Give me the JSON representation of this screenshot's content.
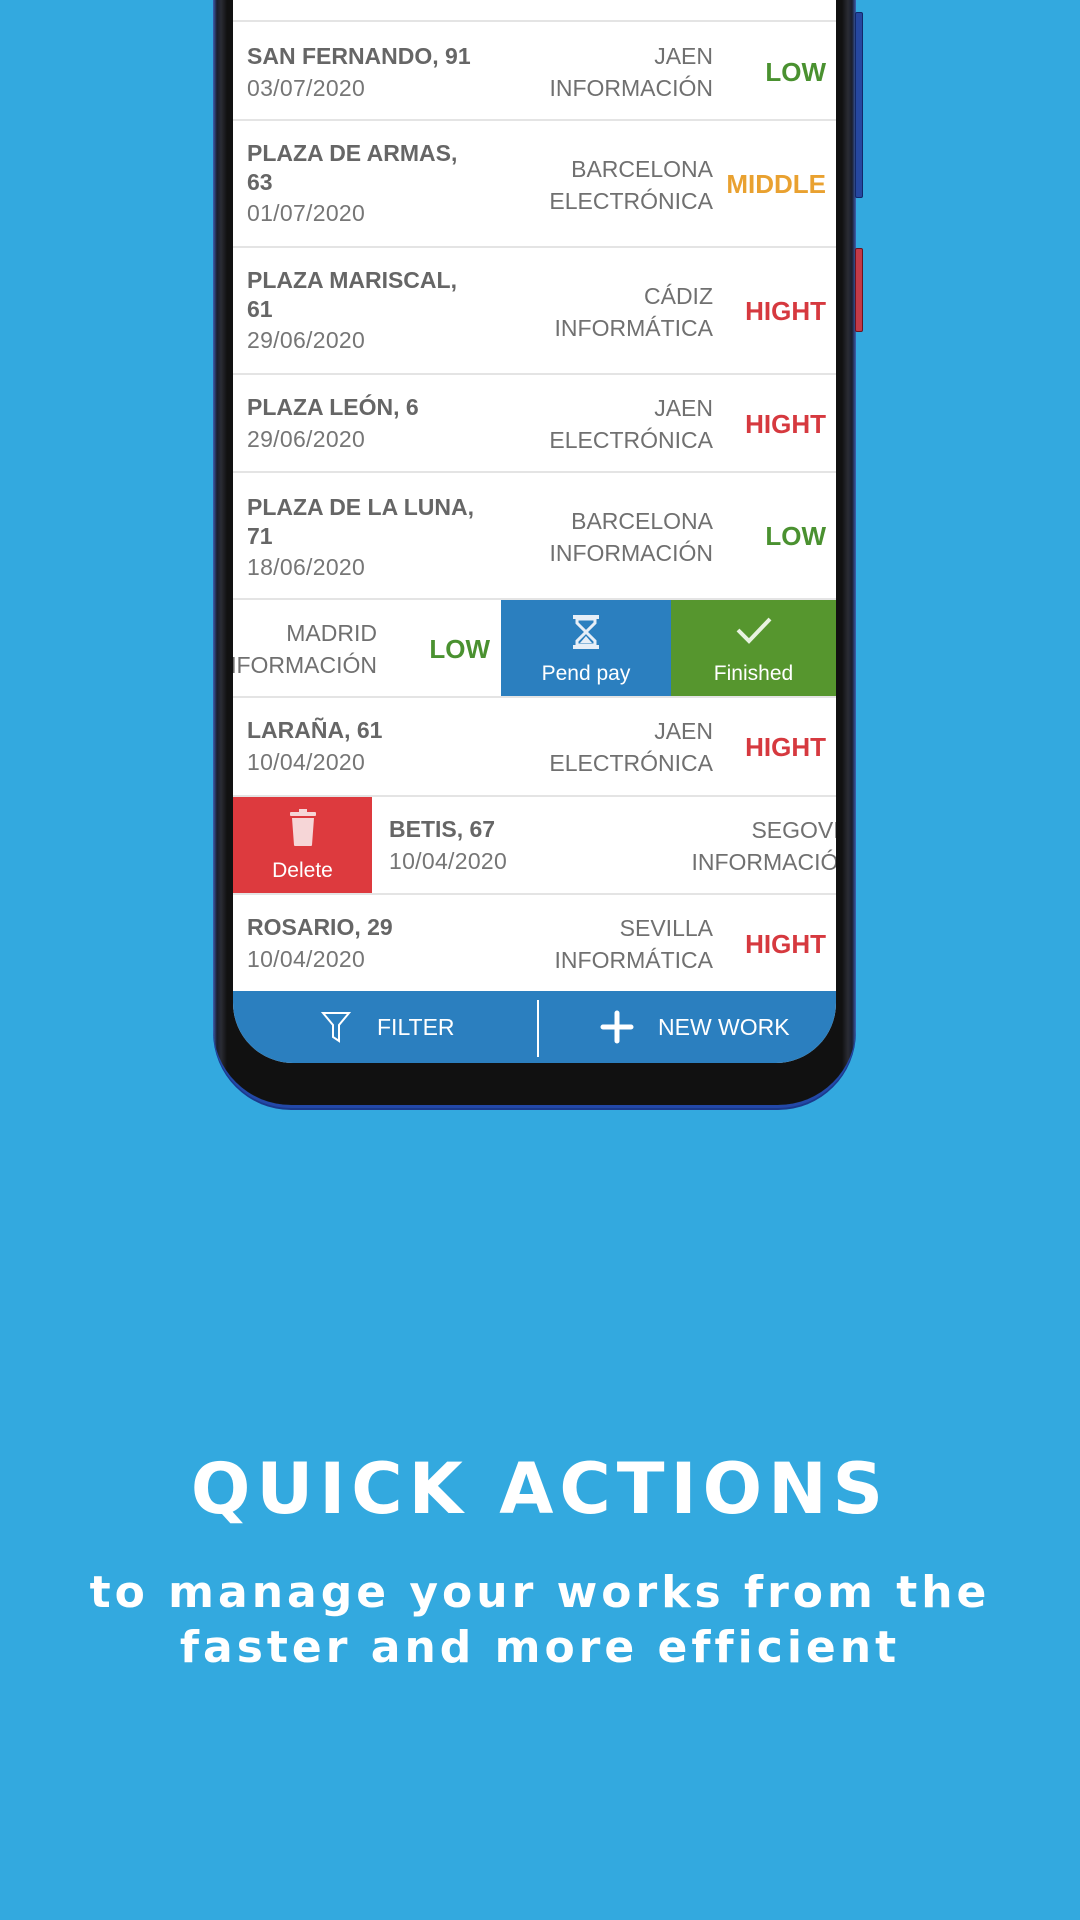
{
  "colors": {
    "background": "#33a9df",
    "low": "#4a9130",
    "middle": "#e9a130",
    "hight": "#d6393f",
    "pend_pay": "#2b7fbf",
    "finished": "#56962e",
    "delete": "#dd3a3e",
    "bottom_bar": "#2b7fbf"
  },
  "works": [
    {
      "address": "SAN FERNANDO, 91",
      "date": "03/07/2020",
      "city": "JAEN",
      "category": "INFORMACIÓN",
      "priority": "LOW"
    },
    {
      "address": "PLAZA DE ARMAS, 63",
      "date": "01/07/2020",
      "city": "BARCELONA",
      "category": "ELECTRÓNICA",
      "priority": "MIDDLE"
    },
    {
      "address": "PLAZA MARISCAL, 61",
      "date": "29/06/2020",
      "city": "CÁDIZ",
      "category": "INFORMÁTICA",
      "priority": "HIGHT"
    },
    {
      "address": "PLAZA LEÓN, 6",
      "date": "29/06/2020",
      "city": "JAEN",
      "category": "ELECTRÓNICA",
      "priority": "HIGHT"
    },
    {
      "address": "PLAZA DE LA LUNA, 71",
      "date": "18/06/2020",
      "city": "BARCELONA",
      "category": "INFORMACIÓN",
      "priority": "LOW"
    },
    {
      "address": "",
      "date": "",
      "city": "MADRID",
      "category": "INFORMACIÓN",
      "priority": "LOW",
      "swipe": "left"
    },
    {
      "address": "LARAÑA, 61",
      "date": "10/04/2020",
      "city": "JAEN",
      "category": "ELECTRÓNICA",
      "priority": "HIGHT"
    },
    {
      "address": "BETIS, 67",
      "date": "10/04/2020",
      "city": "SEGOVIA",
      "category": "INFORMACIÓN",
      "priority": "",
      "swipe": "right"
    },
    {
      "address": "ROSARIO, 29",
      "date": "10/04/2020",
      "city": "SEVILLA",
      "category": "INFORMÁTICA",
      "priority": "HIGHT"
    }
  ],
  "swipe_actions": {
    "pend_pay": {
      "label": "Pend pay",
      "icon": "hourglass-icon"
    },
    "finished": {
      "label": "Finished",
      "icon": "check-icon"
    },
    "delete": {
      "label": "Delete",
      "icon": "trash-icon"
    }
  },
  "bottom_bar": {
    "filter": {
      "label": "FILTER",
      "icon": "filter-icon"
    },
    "new_work": {
      "label": "NEW WORK",
      "icon": "plus-icon"
    }
  },
  "promo": {
    "headline": "QUICK ACTIONS",
    "subline_1": "to manage your works from the",
    "subline_2": "faster and more efficient"
  }
}
